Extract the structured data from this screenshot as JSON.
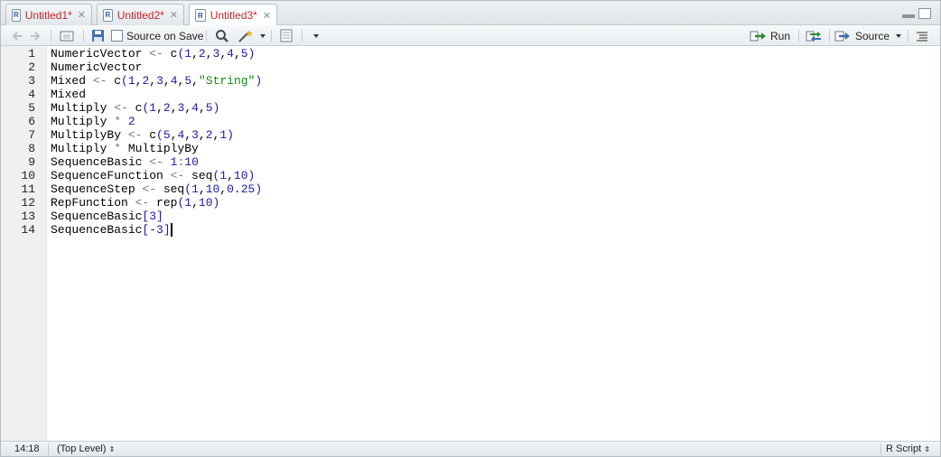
{
  "tabs": [
    {
      "label": "Untitled1*",
      "active": false
    },
    {
      "label": "Untitled2*",
      "active": false
    },
    {
      "label": "Untitled3*",
      "active": true
    }
  ],
  "toolbar": {
    "source_on_save_label": "Source on Save",
    "run_label": "Run",
    "source_label": "Source"
  },
  "lines": [
    {
      "num": "1",
      "code": "NumericVector <- c(1,2,3,4,5)"
    },
    {
      "num": "2",
      "code": "NumericVector"
    },
    {
      "num": "3",
      "code": "Mixed <- c(1,2,3,4,5,\"String\")"
    },
    {
      "num": "4",
      "code": "Mixed"
    },
    {
      "num": "5",
      "code": "Multiply <- c(1,2,3,4,5)"
    },
    {
      "num": "6",
      "code": "Multiply * 2"
    },
    {
      "num": "7",
      "code": "MultiplyBy <- c(5,4,3,2,1)"
    },
    {
      "num": "8",
      "code": "Multiply * MultiplyBy"
    },
    {
      "num": "9",
      "code": "SequenceBasic <- 1:10"
    },
    {
      "num": "10",
      "code": "SequenceFunction <- seq(1,10)"
    },
    {
      "num": "11",
      "code": "SequenceStep <- seq(1,10,0.25)"
    },
    {
      "num": "12",
      "code": "RepFunction <- rep(1,10)"
    },
    {
      "num": "13",
      "code": "SequenceBasic[3]"
    },
    {
      "num": "14",
      "code": "SequenceBasic[-3]"
    }
  ],
  "status": {
    "cursor_position": "14:18",
    "scope": "(Top Level)",
    "file_type": "R Script"
  },
  "colors": {
    "tab_label": "#c0252a",
    "number": "#1a1aa6",
    "string": "#118811",
    "operator": "#777777"
  }
}
